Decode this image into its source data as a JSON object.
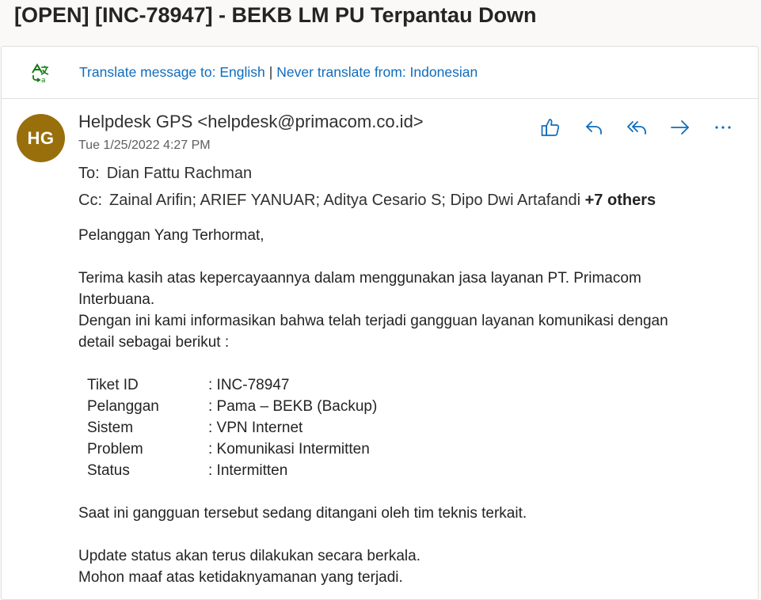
{
  "subject": "[OPEN] [INC-78947] - BEKB LM PU Terpantau Down",
  "translate": {
    "translate_link": "Translate message to: English",
    "separator": "|",
    "never_link": "Never translate from: Indonesian"
  },
  "sender": {
    "initials": "HG",
    "avatar_color": "#986f0b",
    "display": "Helpdesk GPS <helpdesk@primacom.co.id>",
    "date": "Tue 1/25/2022 4:27 PM"
  },
  "recipients": {
    "to_label": "To:",
    "to_value": "Dian Fattu Rachman",
    "cc_label": "Cc:",
    "cc_value": "Zainal Arifin; ARIEF YANUAR; Aditya Cesario S; Dipo Dwi Artafandi",
    "cc_more": "+7 others"
  },
  "actions": [
    "like-icon",
    "reply-icon",
    "reply-all-icon",
    "forward-icon",
    "more-icon"
  ],
  "accent": "#0f6cbd",
  "body": {
    "greeting": "Pelanggan Yang Terhormat,",
    "para1_line1": "Terima kasih atas kepercayaannya dalam menggunakan jasa layanan PT. Primacom",
    "para1_line2": "Interbuana.",
    "para2_line1": "Dengan ini kami informasikan bahwa telah terjadi gangguan layanan komunikasi dengan",
    "para2_line2": "detail sebagai berikut :",
    "details": [
      {
        "key": "Tiket ID",
        "value": ": INC-78947"
      },
      {
        "key": "Pelanggan",
        "value": ": Pama – BEKB (Backup)"
      },
      {
        "key": "Sistem",
        "value": ": VPN Internet"
      },
      {
        "key": "Problem",
        "value": ": Komunikasi Intermitten"
      },
      {
        "key": "Status",
        "value": ": Intermitten"
      }
    ],
    "handling": "Saat ini gangguan tersebut sedang ditangani oleh tim teknis terkait.",
    "update": "Update status akan terus dilakukan secara berkala.",
    "apology": "Mohon maaf atas ketidaknyamanan yang terjadi."
  }
}
